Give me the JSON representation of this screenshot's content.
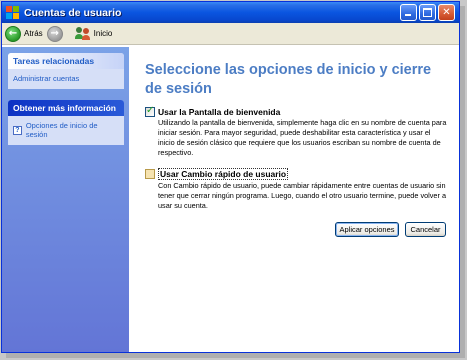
{
  "window": {
    "title": "Cuentas de usuario"
  },
  "toolbar": {
    "back_label": "Atrás",
    "home_label": "Inicio"
  },
  "sidebar": {
    "related_tasks": {
      "title": "Tareas relacionadas",
      "items": [
        {
          "label": "Administrar cuentas"
        }
      ]
    },
    "more_info": {
      "title": "Obtener más información",
      "items": [
        {
          "label": "Opciones de inicio de sesión",
          "icon": "help-icon"
        }
      ]
    }
  },
  "main": {
    "title": "Seleccione las opciones de inicio y cierre de sesión",
    "options": [
      {
        "label": "Usar la Pantalla de bienvenida",
        "checked": true,
        "description": "Utilizando la pantalla de bienvenida, simplemente haga clic en su nombre de cuenta para iniciar sesión. Para mayor seguridad, puede deshabilitar esta característica y usar el inicio de sesión clásico que requiere que los usuarios escriban su nombre de cuenta de respectivo."
      },
      {
        "label": "Usar Cambio rápido de usuario",
        "checked": false,
        "description": "Con Cambio rápido de usuario, puede cambiar rápidamente entre cuentas de usuario sin tener que cerrar ningún programa. Luego, cuando el otro usuario termine, puede volver a usar su cuenta."
      }
    ],
    "apply_label": "Aplicar opciones",
    "cancel_label": "Cancelar"
  },
  "colors": {
    "titlebar": "#0a55e0",
    "sidebar": "#6f8fdc",
    "heading": "#4c7dc4",
    "link": "#215dc6"
  }
}
